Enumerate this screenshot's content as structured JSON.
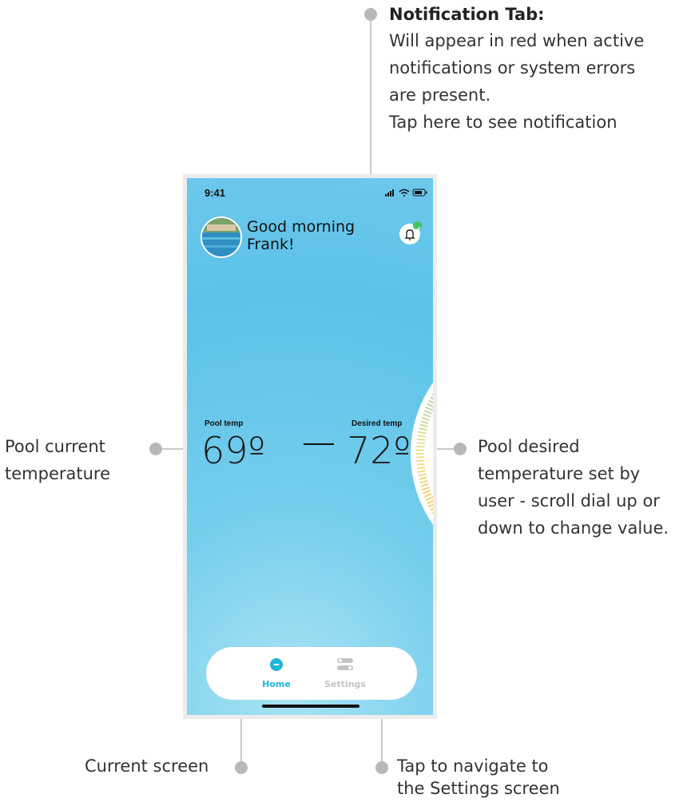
{
  "annotations": {
    "notification": {
      "title": "Notification Tab:",
      "lines": [
        "Will appear in red when active",
        "notifications or system errors",
        "are present.",
        "Tap here to see notification"
      ]
    },
    "pool_current": {
      "lines": [
        "Pool current",
        "temperature"
      ]
    },
    "pool_desired": {
      "lines": [
        "Pool desired",
        "temperature set by",
        "user - scroll dial up or",
        "down to change value."
      ]
    },
    "current_screen": {
      "lines": [
        "Current screen"
      ]
    },
    "settings_nav": {
      "lines": [
        "Tap to navigate to",
        "the Settings screen"
      ]
    }
  },
  "phone": {
    "status": {
      "time": "9:41",
      "icons": [
        "signal-icon",
        "wifi-icon",
        "battery-icon"
      ]
    },
    "greeting": {
      "line1": "Good morning",
      "line2": "Frank!"
    },
    "pool_temp": {
      "label": "Pool temp",
      "value": "69º"
    },
    "desired_temp": {
      "label": "Desired temp",
      "value": "72º"
    },
    "nav": {
      "home_label": "Home",
      "settings_label": "Settings"
    },
    "colors": {
      "accent": "#1fb6d9",
      "inactive": "#c4c4c4",
      "notification_ok": "#41c463",
      "dial_warm": "#f0a53c",
      "dial_cool": "#5cb8e6"
    }
  }
}
